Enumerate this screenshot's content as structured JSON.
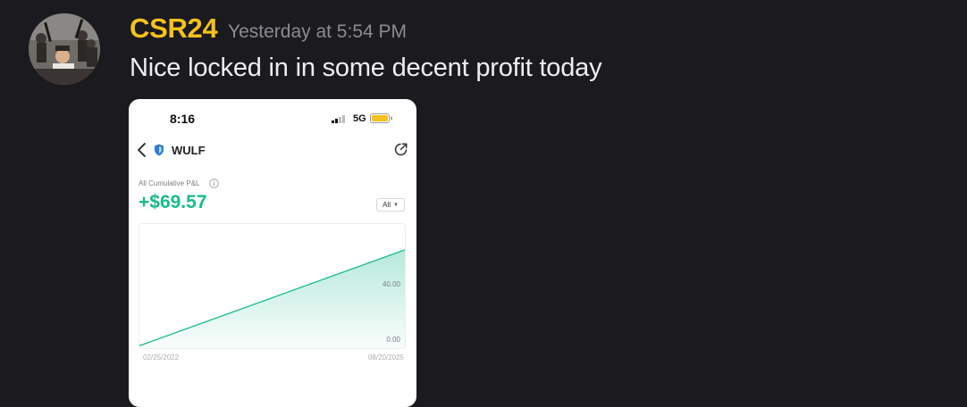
{
  "message": {
    "username": "CSR24",
    "timestamp": "Yesterday at 5:54 PM",
    "text": "Nice locked in in some decent profit today",
    "username_color": "#f3c21d"
  },
  "phone": {
    "status_time": "8:16",
    "network": "5G",
    "ticker": "WULF",
    "pnl_label": "All Cumulative P&L",
    "pnl_value": "+$69.57",
    "range_label": "All",
    "accent_color": "#1aba8d"
  },
  "chart_data": {
    "type": "area",
    "x": [
      "02/25/2022",
      "08/20/2025"
    ],
    "values": [
      0,
      69.57
    ],
    "y_ticks": [
      "40.00",
      "0.00"
    ],
    "ylim": [
      -3,
      88
    ],
    "title": "",
    "xlabel": "",
    "ylabel": "",
    "grid": false,
    "color": "#1aba8d"
  }
}
